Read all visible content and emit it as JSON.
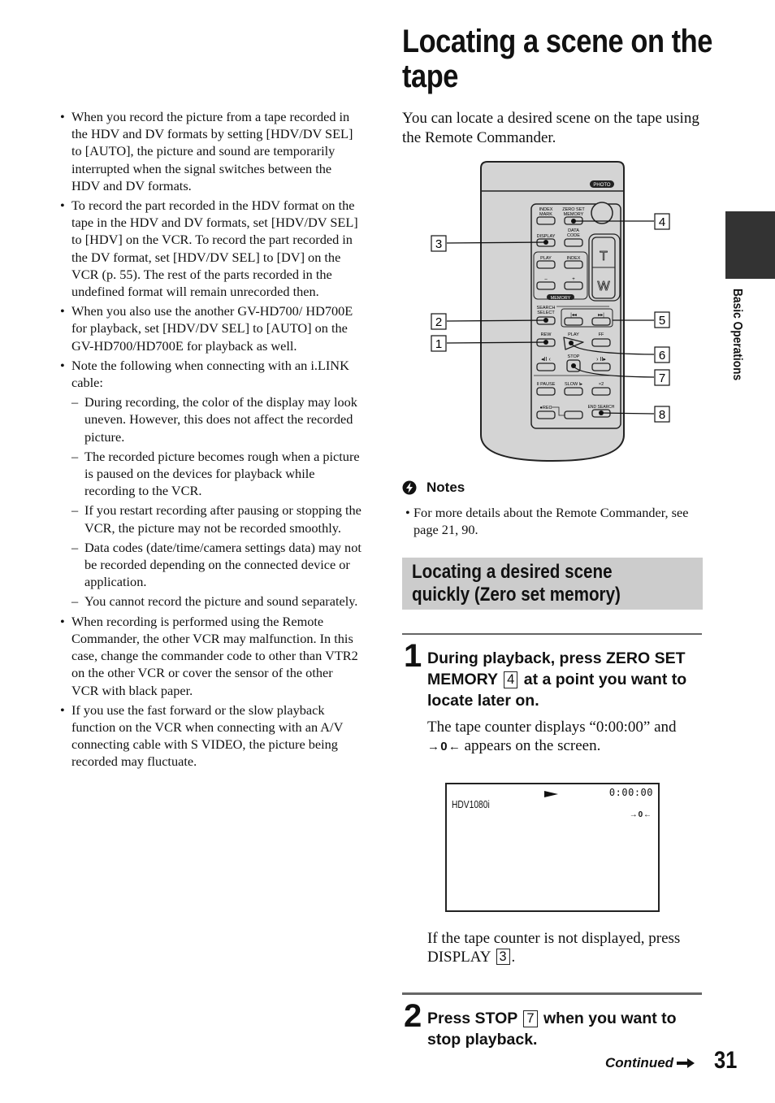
{
  "left_column": {
    "items": [
      {
        "type": "bullet",
        "text": "When you record the picture from a tape recorded in the HDV and DV formats by setting [HDV/DV SEL] to [AUTO], the picture and sound are temporarily interrupted when the signal switches between the HDV and DV formats."
      },
      {
        "type": "bullet",
        "text": "To record the part recorded in the HDV format on the tape in the HDV and DV formats, set [HDV/DV SEL] to [HDV] on the VCR. To record the part recorded in the DV format, set [HDV/DV SEL] to [DV] on the VCR (p. 55). The rest of the parts recorded in the undefined format will remain unrecorded then."
      },
      {
        "type": "bullet",
        "text": "When you also use the another GV-HD700/ HD700E for playback, set [HDV/DV SEL] to [AUTO] on the GV-HD700/HD700E for playback as well."
      },
      {
        "type": "bullet",
        "text": "Note the following when connecting with an i.LINK cable:"
      },
      {
        "type": "dash",
        "text": "During recording, the color of the display may look uneven. However, this does not affect the recorded picture."
      },
      {
        "type": "dash",
        "text": "The recorded picture becomes rough when a picture is paused on the devices for playback while recording to the VCR."
      },
      {
        "type": "dash",
        "text": "If you restart recording after pausing or stopping the VCR, the picture may not be recorded smoothly."
      },
      {
        "type": "dash",
        "text": "Data codes (date/time/camera settings data) may not be recorded depending on the connected device or application."
      },
      {
        "type": "dash",
        "text": "You cannot record the picture and sound separately."
      },
      {
        "type": "bullet",
        "text": "When recording is performed using the Remote Commander, the other VCR may malfunction. In this case, change the commander code to other than VTR2 on the other VCR or cover the sensor of the other VCR with black paper."
      },
      {
        "type": "bullet",
        "text": "If you use the fast forward or the slow playback function on the VCR when connecting with an A/V connecting cable with S VIDEO, the picture being recorded may fluctuate."
      }
    ]
  },
  "title": "Locating a scene on the tape",
  "intro": "You can locate a desired scene on the tape using the Remote Commander.",
  "remote": {
    "buttons": {
      "photo": "PHOTO",
      "index_mark": [
        "INDEX",
        "MARK"
      ],
      "zero_set_memory": [
        "ZERO SET",
        "MEMORY"
      ],
      "display": "DISPLAY",
      "data_code": [
        "DATA",
        "CODE"
      ],
      "play": "PLAY",
      "index": "INDEX",
      "minus": "–",
      "plus": "+",
      "memory": "MEMORY",
      "search_select": [
        "SEARCH",
        "SELECT"
      ],
      "rew": "REW",
      "play2": "PLAY",
      "ff": "FF",
      "stop": "STOP",
      "pause": "II PAUSE",
      "slow": "SLOW I▸",
      "x2": "×2",
      "rec": "●REC",
      "end_search": "END SEARCH",
      "zoom_t": "T",
      "zoom_w": "W"
    },
    "callouts": [
      "1",
      "2",
      "3",
      "4",
      "5",
      "6",
      "7",
      "8"
    ]
  },
  "notes": {
    "heading": "Notes",
    "items": [
      "For more details about the Remote Commander, see page 21, 90."
    ]
  },
  "section": {
    "title_line1": "Locating a desired scene",
    "title_line2": "quickly (Zero set memory)"
  },
  "steps": [
    {
      "number": "1",
      "text_before": "During playback, press ZERO SET MEMORY",
      "ref": "4",
      "text_after": "at a point you want to locate later on.",
      "body_line1": "The tape counter displays “0:00:00” and",
      "zero_mark": "→ 0 ←",
      "body_line2": "appears on the screen.",
      "screen": {
        "format": "HDV1080i",
        "counter": "0:00:00",
        "zero_mark": "→ 0 ←"
      },
      "after_text_before": "If the tape counter is not displayed, press DISPLAY",
      "after_ref": "3",
      "after_text_after": "."
    },
    {
      "number": "2",
      "text_before": "Press STOP",
      "ref": "7",
      "text_after": "when you want to stop playback."
    }
  ],
  "sidebar": {
    "label": "Basic Operations"
  },
  "footer": {
    "continued": "Continued",
    "page_number": "31"
  }
}
